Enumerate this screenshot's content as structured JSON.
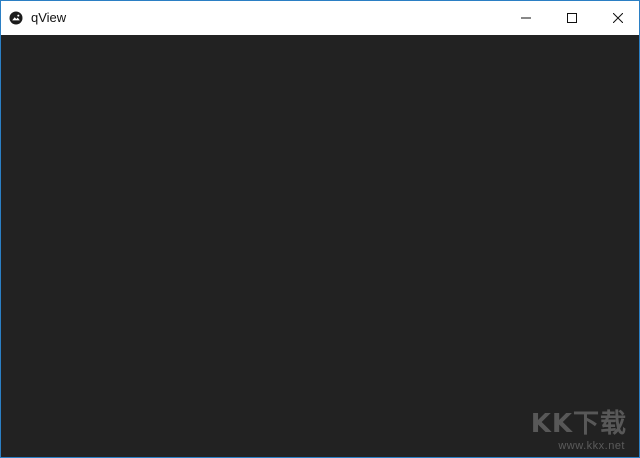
{
  "window": {
    "title": "qView",
    "title_icon": "app-logo-icon",
    "colors": {
      "titlebar": "#ffffff",
      "content": "#222222",
      "border": "#2b7fc4"
    }
  },
  "caption_buttons": [
    {
      "name": "minimize",
      "icon": "minimize-icon"
    },
    {
      "name": "maximize",
      "icon": "maximize-icon"
    },
    {
      "name": "close",
      "icon": "close-icon"
    }
  ],
  "watermark": {
    "text": "KK下载",
    "url": "www.kkx.net"
  }
}
